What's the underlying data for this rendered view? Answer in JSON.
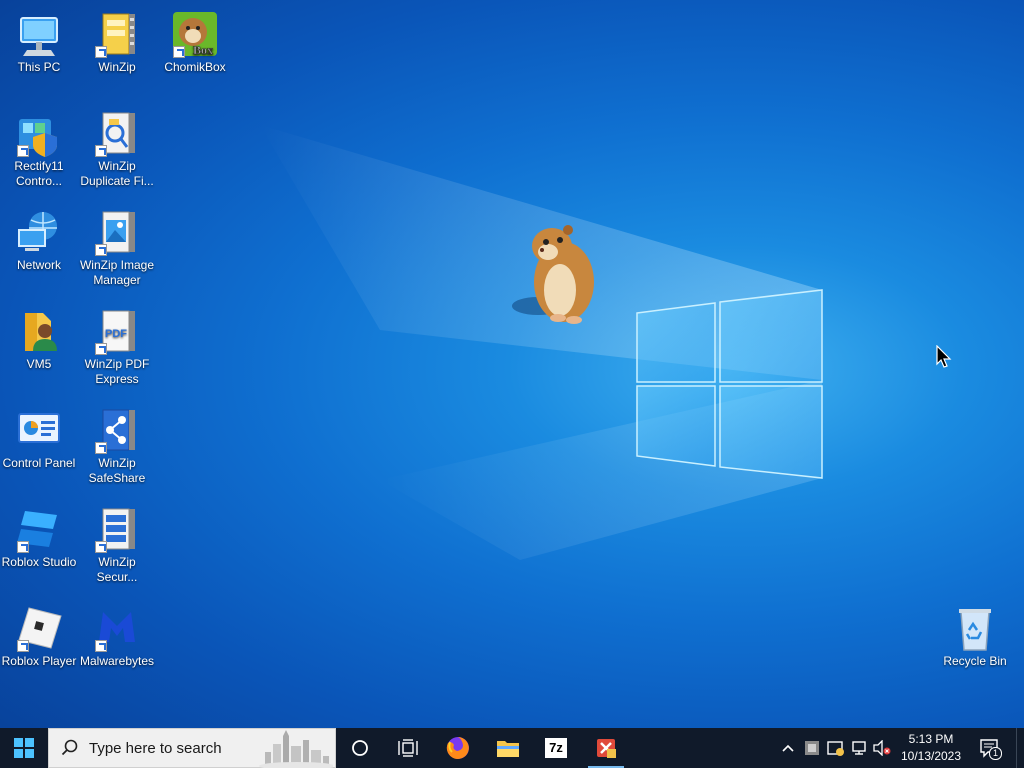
{
  "desktop": {
    "icons": [
      {
        "label": "This PC",
        "icon": "this-pc-icon"
      },
      {
        "label": "WinZip",
        "icon": "winzip-icon"
      },
      {
        "label": "ChomikBox",
        "icon": "chomikbox-icon",
        "badge_text": "Box"
      },
      {
        "label": "Rectify11 Contro...",
        "icon": "rectify11-icon"
      },
      {
        "label": "WinZip Duplicate Fi...",
        "icon": "winzip-duplicate-icon"
      },
      {
        "label": "Network",
        "icon": "network-icon"
      },
      {
        "label": "WinZip Image Manager",
        "icon": "winzip-image-icon"
      },
      {
        "label": "VM5",
        "icon": "folder-user-icon"
      },
      {
        "label": "WinZip PDF Express",
        "icon": "winzip-pdf-icon",
        "badge_text": "PDF"
      },
      {
        "label": "Control Panel",
        "icon": "control-panel-icon"
      },
      {
        "label": "WinZip SafeShare",
        "icon": "winzip-safeshare-icon"
      },
      {
        "label": "Roblox Studio",
        "icon": "roblox-studio-icon"
      },
      {
        "label": "WinZip Secur...",
        "icon": "winzip-secure-icon"
      },
      {
        "label": "Roblox Player",
        "icon": "roblox-player-icon"
      },
      {
        "label": "Malwarebytes",
        "icon": "malwarebytes-icon"
      },
      {
        "label": "Recycle Bin",
        "icon": "recycle-bin-icon"
      }
    ]
  },
  "taskbar": {
    "search_placeholder": "Type here to search",
    "pinned": [
      "firefox-icon",
      "file-explorer-icon",
      "7zip-icon",
      "app-icon"
    ],
    "pinned_7z_text": "7z",
    "clock_time": "5:13 PM",
    "clock_date": "10/13/2023",
    "notification_count": "1"
  },
  "colors": {
    "desktop_blue": "#0f6fd0",
    "taskbar": "#101a2a",
    "accent": "#76b9ed"
  }
}
